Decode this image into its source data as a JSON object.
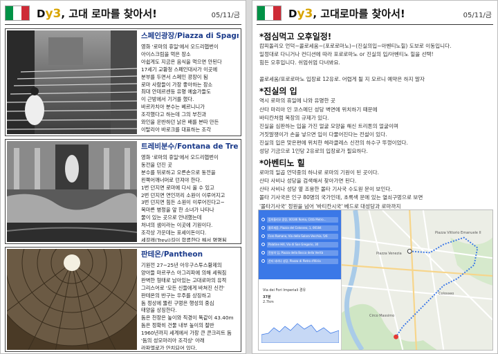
{
  "left": {
    "header": {
      "title_prefix": "D",
      "title_big": "y3",
      "title_rest": ", 고대 로마를 찾아서!",
      "date": "05/11/금"
    },
    "flag_colors": [
      "#009246",
      "#ffffff",
      "#ce2b37"
    ],
    "sections": [
      {
        "title": "스페인광장/Piazza di Spagna",
        "lines": [
          "영화 '로마의 휴일'에서 오드리헵번이",
          "아이스크림을 먹은 장소",
          "아쉽게도 지금은 음식을 먹으면 안된다",
          "17세기 교황청 스페인대사가 이곳에",
          "분부를 두면서 스페인 광장이 됨",
          "로마 사람들이 가장 좋아하는 장소",
          "최대 안데르센등 유명 예술가들도",
          "이 근방에서 기거를 했다.",
          "바르카치아 분수는 베르니니가",
          "조각했다고 하는데 그의 부친과",
          "와인을 운반하던 낡은 배를 본따 만든",
          "이탈리아 바로크를 대표하는 조각"
        ]
      },
      {
        "title": "트레비분수/Fontana de Trevi",
        "lines": [
          "영화 '로마의 휴일'에서 오드리헵번이",
          "동전을 던진 곳",
          "분수를 뒤로하고 오른손으로 동전을",
          "왼쪽어깨너머로 던져야 한다.",
          "1번 던지면 로마에 다시 올 수 있고",
          "2번 던지면 연인끼리 소원이 이루어지고",
          "3번 던지면 힘든 소원이 이루어진다고~",
          "목마른 병정을 앞 한 소녀가 나타나",
          "물이 있는 곳으로 안내했는데",
          "처녀의 샘이라는 이곳에 기원이다.",
          "조각상 가운데는 포세이돈이다.",
          "세갈래(Trevi)길이 합류한다 해서 명명됨"
        ]
      },
      {
        "title": "판테온/Pantheon",
        "lines": [
          "기원전 27~25년 아우구스투스황제의",
          "양아들 마르쿠스 아그리파에 의해 세워짐",
          "완벽한 형태로 남아있는 고대로마의 유적",
          "그리스어로 '모든 신들에게 바쳐진 신전'",
          "판테온의 반구는 우주를 상징하고",
          "돔 정상에 뚫린 구멍은 행성의 중심",
          "태양을 상징한다.",
          "돔은 천장은 높이와 직경이 똑같이 43.40m",
          "돔은 정확히 건물 내부 높이의 절반",
          "1960년까지 세계에서 가장 큰 콘크리트 돔",
          "'돔의 성모마리아 조각상' 아래",
          "라파엘로가 안치되어 있다."
        ]
      }
    ]
  },
  "right": {
    "header": {
      "title_prefix": "D",
      "title_big": "y3",
      "title_rest": ", 고대로마를 찾아서!",
      "date": "05/11/금"
    },
    "blocks": [
      {
        "heading": "*점심먹고 오후일정!",
        "lines": [
          "캄피돌리오 언덕~콜로세움~(포로로마노)~(진실의입~아벤티노힐) 도보로 이동입니다.",
          "일정대로 다니거나 컨디션에 따라 포로로마노 or 진실의 입/아벤티노 힐을 선택!",
          "힘든 오후입니다. 쉬엄쉬엄 다녀봐요.",
          "",
          "콜로세움/포로로마노 입장료 12유로. 어렵게 될 지 모르니 예약은 하지 말자"
        ]
      },
      {
        "heading": "*진실의 입",
        "lines": [
          "역시 로마의 휴일에 나와 유명한 곳",
          "산타 마리아 인 코스메딘 성당 벽면에 위치하기 때문에",
          "바티칸처럼 복장의 규제가 있다.",
          "진실을 심판하는 입을 가진 얼굴 모양을 해신 트리톤의 얼굴이며",
          "거짓말쟁이가 손을 넣으면 입이 다물어진다는 전설이 있다.",
          "진실의 입은 맞은편에 위치한 헤라클레스 신전의 하수구 뚜껑이었다.",
          "성당 기금으로 1인당 2유로의 입장료가 필요하다."
        ]
      },
      {
        "heading": "*아벤티노 힐",
        "lines": [
          "로마의 일곱 언덕중의 하나로 로마의 기원이 된 곳이다.",
          "산타 사비나 성당을 검색해서 찾아가면 된다.",
          "산타 사비나 성당 옆 조용한 몰타 기사국 수도원 문이 보인다.",
          "몰타 기사국은 인구 80명의 국가인데, 초록색 문에 있는 열쇠구멍으로 보면",
          "'몰타기사국' 정원을 넘어 '바티칸시국' 베드로 대성당과 로마까지",
          "하나의 구멍으로 3개국을 보는 신기한 경험을 할 수 있다."
        ]
      }
    ],
    "map": {
      "directions": [
        "캄피돌리오 광장, 00186 Roma, Città Metro...",
        "콜로세움, Piazza del Colosseo, 1, 00184",
        "Foro Romano, Via della Salara Vecchia, 5/6",
        "Palatine Hill, Via di San Gregorio, 30",
        "진실의 입, Piazza della Bocca della Verità",
        "산타 사비나 성당, Piazza di Pietro d'Illiria"
      ],
      "route_summary": "Via dei Fori Imperiali 경유",
      "time": "37분",
      "distance": "2.7km",
      "labels": [
        "Piazza Vittorio Emanuele II",
        "Colosseo",
        "Circo Massimo",
        "Piazza Venezia"
      ]
    }
  }
}
